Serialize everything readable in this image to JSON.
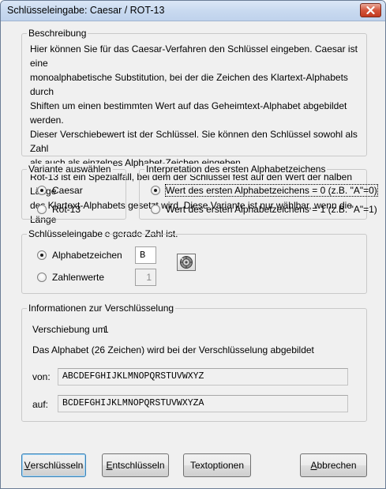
{
  "window": {
    "title": "Schlüsseleingabe: Caesar / ROT-13"
  },
  "description": {
    "label": "Beschreibung",
    "lines": [
      "Hier können Sie für das Caesar-Verfahren den Schlüssel eingeben. Caesar ist eine",
      "monoalphabetische Substitution, bei der die Zeichen des Klartext-Alphabets durch",
      "Shiften um einen bestimmten Wert auf das Geheimtext-Alphabet abgebildet werden.",
      "Dieser Verschiebewert ist der Schlüssel. Sie können den Schlüssel sowohl als Zahl",
      "als auch als einzelnes Alphabet-Zeichen eingeben.",
      "Rot-13 ist ein Spezialfall, bei dem der Schlüssel fest auf den Wert der halben Länge",
      "des Klartext-Alphabets gesetzt wird. Diese Variante ist nur wählbar, wenn die Länge",
      "des Alphabets eine gerade Zahl ist."
    ]
  },
  "variant": {
    "label": "Variante auswählen",
    "options": [
      {
        "label": "Caesar",
        "checked": true
      },
      {
        "label": "Rot-13",
        "checked": false
      }
    ]
  },
  "interpretation": {
    "label": "Interpretation des ersten Alphabetzeichens",
    "options": [
      {
        "label": "Wert des ersten Alphabetzeichens = 0 (z.B. \"A\"=0)",
        "checked": true
      },
      {
        "label": "Wert des ersten Alphabetzeichens = 1 (z.B. \"A\"=1)",
        "checked": false
      }
    ]
  },
  "key_input": {
    "label": "Schlüsseleingabe",
    "options": [
      {
        "label": "Alphabetzeichen",
        "checked": true,
        "value": "B"
      },
      {
        "label": "Zahlenwerte",
        "checked": false,
        "value": "1"
      }
    ]
  },
  "info": {
    "label": "Informationen zur Verschlüsselung",
    "shift_label": "Verschiebung um",
    "shift_value": "1",
    "alphabet_note": "Das Alphabet (26 Zeichen) wird bei der Verschlüsselung abgebildet",
    "from_label": "von:",
    "from_value": "ABCDEFGHIJKLMNOPQRSTUVWXYZ",
    "to_label": "auf:",
    "to_value": "BCDEFGHIJKLMNOPQRSTUVWXYZA"
  },
  "buttons": {
    "encrypt": {
      "first": "V",
      "rest": "erschlüsseln"
    },
    "decrypt": {
      "first": "E",
      "rest": "ntschlüsseln"
    },
    "text_options": {
      "label": "Textoptionen"
    },
    "cancel": {
      "first": "A",
      "rest": "bbrechen"
    }
  },
  "icons": {
    "close": "close-icon",
    "key_tool": "wheel-icon"
  }
}
